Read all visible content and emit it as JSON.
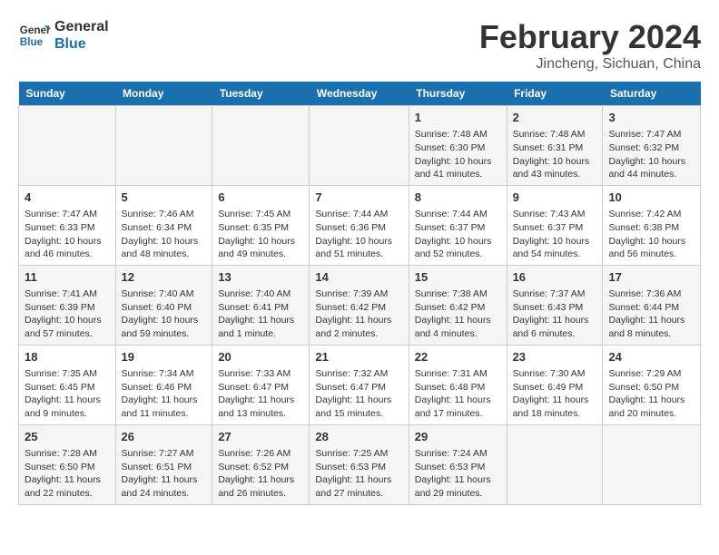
{
  "header": {
    "logo_line1": "General",
    "logo_line2": "Blue",
    "title": "February 2024",
    "location": "Jincheng, Sichuan, China"
  },
  "weekdays": [
    "Sunday",
    "Monday",
    "Tuesday",
    "Wednesday",
    "Thursday",
    "Friday",
    "Saturday"
  ],
  "weeks": [
    [
      {
        "day": "",
        "info": ""
      },
      {
        "day": "",
        "info": ""
      },
      {
        "day": "",
        "info": ""
      },
      {
        "day": "",
        "info": ""
      },
      {
        "day": "1",
        "info": "Sunrise: 7:48 AM\nSunset: 6:30 PM\nDaylight: 10 hours\nand 41 minutes."
      },
      {
        "day": "2",
        "info": "Sunrise: 7:48 AM\nSunset: 6:31 PM\nDaylight: 10 hours\nand 43 minutes."
      },
      {
        "day": "3",
        "info": "Sunrise: 7:47 AM\nSunset: 6:32 PM\nDaylight: 10 hours\nand 44 minutes."
      }
    ],
    [
      {
        "day": "4",
        "info": "Sunrise: 7:47 AM\nSunset: 6:33 PM\nDaylight: 10 hours\nand 46 minutes."
      },
      {
        "day": "5",
        "info": "Sunrise: 7:46 AM\nSunset: 6:34 PM\nDaylight: 10 hours\nand 48 minutes."
      },
      {
        "day": "6",
        "info": "Sunrise: 7:45 AM\nSunset: 6:35 PM\nDaylight: 10 hours\nand 49 minutes."
      },
      {
        "day": "7",
        "info": "Sunrise: 7:44 AM\nSunset: 6:36 PM\nDaylight: 10 hours\nand 51 minutes."
      },
      {
        "day": "8",
        "info": "Sunrise: 7:44 AM\nSunset: 6:37 PM\nDaylight: 10 hours\nand 52 minutes."
      },
      {
        "day": "9",
        "info": "Sunrise: 7:43 AM\nSunset: 6:37 PM\nDaylight: 10 hours\nand 54 minutes."
      },
      {
        "day": "10",
        "info": "Sunrise: 7:42 AM\nSunset: 6:38 PM\nDaylight: 10 hours\nand 56 minutes."
      }
    ],
    [
      {
        "day": "11",
        "info": "Sunrise: 7:41 AM\nSunset: 6:39 PM\nDaylight: 10 hours\nand 57 minutes."
      },
      {
        "day": "12",
        "info": "Sunrise: 7:40 AM\nSunset: 6:40 PM\nDaylight: 10 hours\nand 59 minutes."
      },
      {
        "day": "13",
        "info": "Sunrise: 7:40 AM\nSunset: 6:41 PM\nDaylight: 11 hours\nand 1 minute."
      },
      {
        "day": "14",
        "info": "Sunrise: 7:39 AM\nSunset: 6:42 PM\nDaylight: 11 hours\nand 2 minutes."
      },
      {
        "day": "15",
        "info": "Sunrise: 7:38 AM\nSunset: 6:42 PM\nDaylight: 11 hours\nand 4 minutes."
      },
      {
        "day": "16",
        "info": "Sunrise: 7:37 AM\nSunset: 6:43 PM\nDaylight: 11 hours\nand 6 minutes."
      },
      {
        "day": "17",
        "info": "Sunrise: 7:36 AM\nSunset: 6:44 PM\nDaylight: 11 hours\nand 8 minutes."
      }
    ],
    [
      {
        "day": "18",
        "info": "Sunrise: 7:35 AM\nSunset: 6:45 PM\nDaylight: 11 hours\nand 9 minutes."
      },
      {
        "day": "19",
        "info": "Sunrise: 7:34 AM\nSunset: 6:46 PM\nDaylight: 11 hours\nand 11 minutes."
      },
      {
        "day": "20",
        "info": "Sunrise: 7:33 AM\nSunset: 6:47 PM\nDaylight: 11 hours\nand 13 minutes."
      },
      {
        "day": "21",
        "info": "Sunrise: 7:32 AM\nSunset: 6:47 PM\nDaylight: 11 hours\nand 15 minutes."
      },
      {
        "day": "22",
        "info": "Sunrise: 7:31 AM\nSunset: 6:48 PM\nDaylight: 11 hours\nand 17 minutes."
      },
      {
        "day": "23",
        "info": "Sunrise: 7:30 AM\nSunset: 6:49 PM\nDaylight: 11 hours\nand 18 minutes."
      },
      {
        "day": "24",
        "info": "Sunrise: 7:29 AM\nSunset: 6:50 PM\nDaylight: 11 hours\nand 20 minutes."
      }
    ],
    [
      {
        "day": "25",
        "info": "Sunrise: 7:28 AM\nSunset: 6:50 PM\nDaylight: 11 hours\nand 22 minutes."
      },
      {
        "day": "26",
        "info": "Sunrise: 7:27 AM\nSunset: 6:51 PM\nDaylight: 11 hours\nand 24 minutes."
      },
      {
        "day": "27",
        "info": "Sunrise: 7:26 AM\nSunset: 6:52 PM\nDaylight: 11 hours\nand 26 minutes."
      },
      {
        "day": "28",
        "info": "Sunrise: 7:25 AM\nSunset: 6:53 PM\nDaylight: 11 hours\nand 27 minutes."
      },
      {
        "day": "29",
        "info": "Sunrise: 7:24 AM\nSunset: 6:53 PM\nDaylight: 11 hours\nand 29 minutes."
      },
      {
        "day": "",
        "info": ""
      },
      {
        "day": "",
        "info": ""
      }
    ]
  ]
}
